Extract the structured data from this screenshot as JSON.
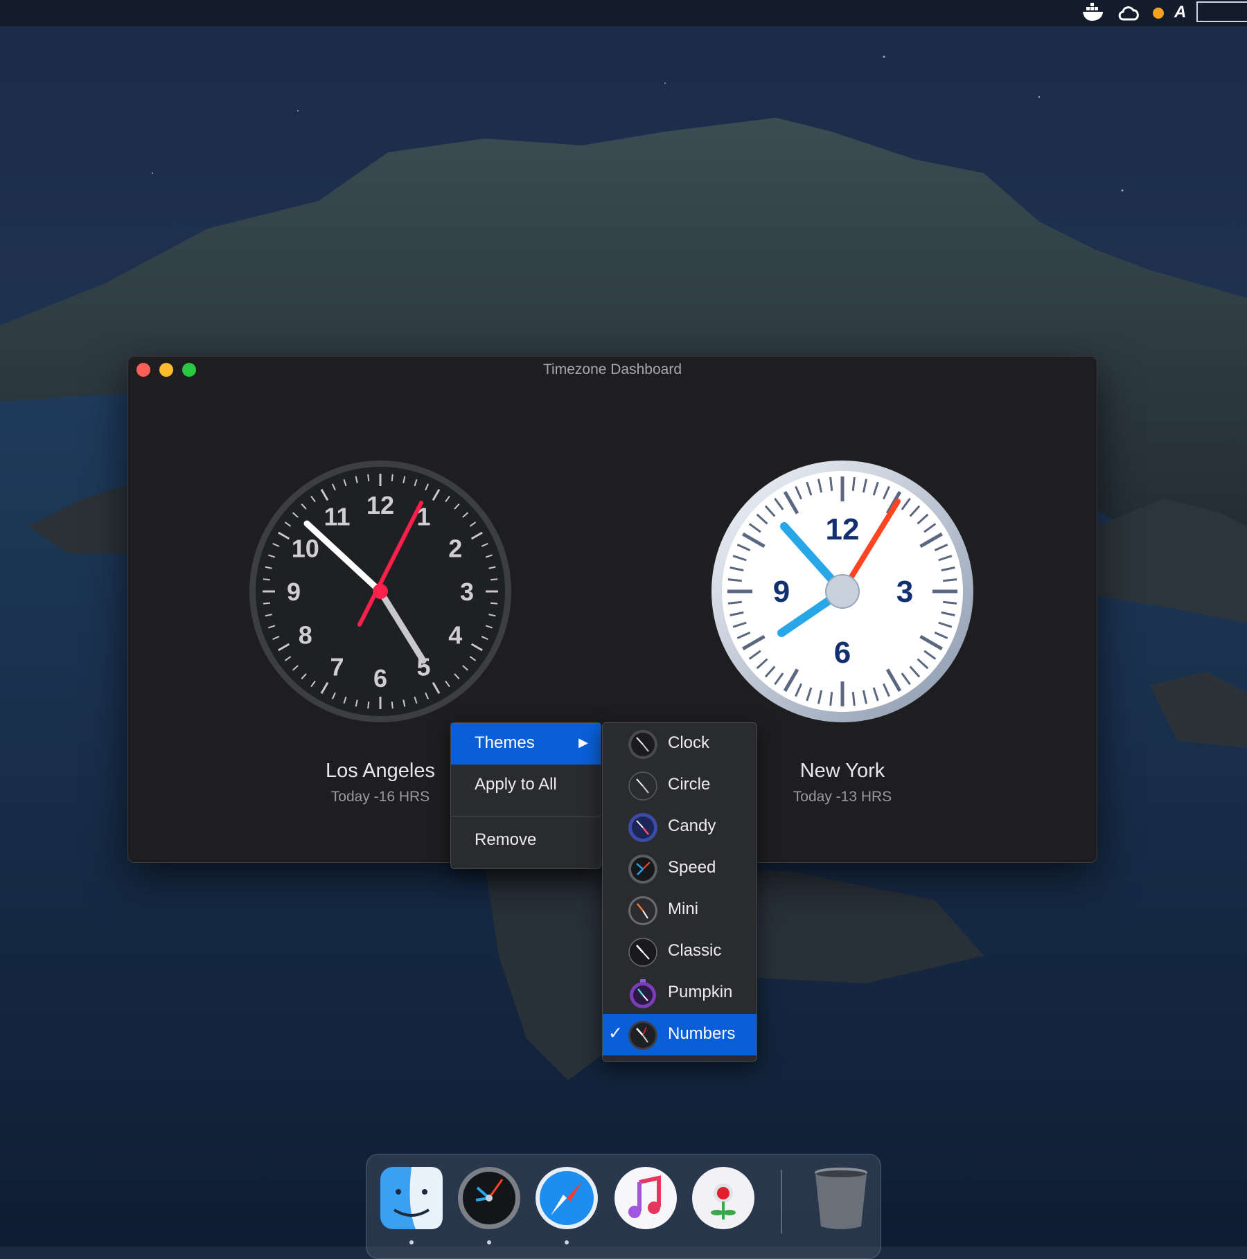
{
  "window": {
    "title": "Timezone Dashboard"
  },
  "clocks": [
    {
      "city": "Los Angeles",
      "offset": "Today -16 HRS",
      "dial_numbers": [
        "12",
        "1",
        "2",
        "3",
        "4",
        "5",
        "6",
        "7",
        "8",
        "9",
        "10",
        "11"
      ]
    },
    {
      "city": "New York",
      "offset": "Today -13 HRS",
      "dial_numbers": [
        "12",
        "3",
        "6",
        "9"
      ]
    }
  ],
  "context_menu": {
    "items": [
      {
        "label": "Themes",
        "has_submenu": true,
        "selected": true
      },
      {
        "label": "Apply to All"
      },
      {
        "label": "Remove"
      }
    ]
  },
  "themes_submenu": {
    "items": [
      {
        "label": "Clock"
      },
      {
        "label": "Circle"
      },
      {
        "label": "Candy"
      },
      {
        "label": "Speed"
      },
      {
        "label": "Mini"
      },
      {
        "label": "Classic"
      },
      {
        "label": "Pumpkin"
      },
      {
        "label": "Numbers",
        "checked": true
      }
    ],
    "check_glyph": "✓",
    "arrow_glyph": "▶"
  },
  "menubar": {
    "icons": [
      "docker-whale-icon",
      "creative-cloud-icon",
      "orange-dot-icon",
      "font-a-icon",
      "status-box-icon"
    ],
    "font_icon_label": "A"
  },
  "dock": {
    "apps": [
      "finder-icon",
      "timezone-clock-icon",
      "safari-icon",
      "music-icon",
      "flower-app-icon",
      "trash-icon"
    ]
  },
  "colors": {
    "accent": "#0a5fd8",
    "second_hand_red": "#ff1f4b",
    "ny_second_hand": "#ff4422",
    "ny_hand_blue": "#27a7e8",
    "ny_numerals": "#13306e"
  }
}
